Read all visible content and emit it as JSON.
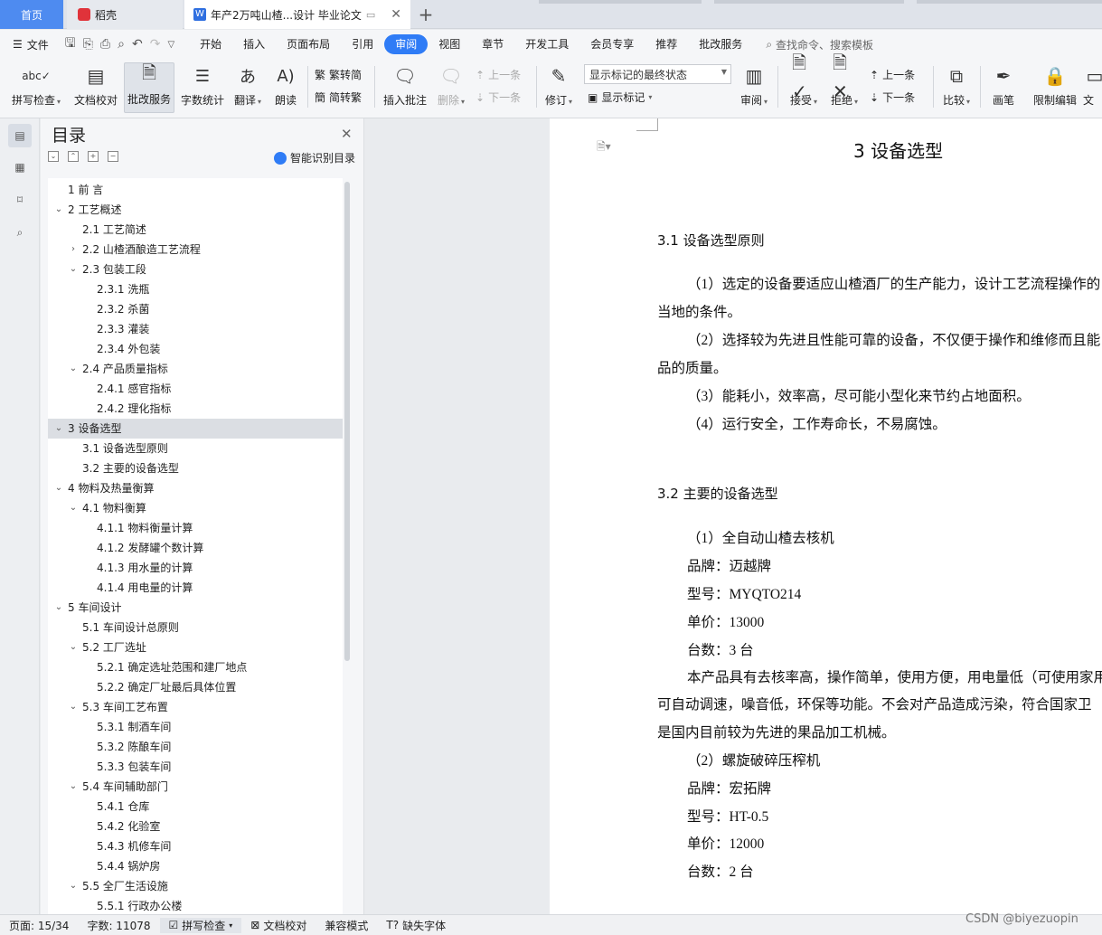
{
  "tabs": {
    "home": "首页",
    "daoke": "稻壳",
    "doc": "年产2万吨山楂...设计 毕业论文"
  },
  "menu": {
    "file": "文件",
    "items": [
      "开始",
      "插入",
      "页面布局",
      "引用",
      "审阅",
      "视图",
      "章节",
      "开发工具",
      "会员专享",
      "推荐",
      "批改服务"
    ],
    "active": "审阅",
    "search": "查找命令、搜索模板"
  },
  "ribbon": {
    "spell": "拼写检查",
    "doccheck": "文档校对",
    "correction": "批改服务",
    "wordcount": "字数统计",
    "translate": "翻译",
    "read": "朗读",
    "trad": "繁转简",
    "simp": "简转繁",
    "insert_comment": "插入批注",
    "delete": "删除",
    "prev": "上一条",
    "next": "下一条",
    "revise": "修订",
    "markup_state": "显示标记的最终状态",
    "show_markup": "显示标记",
    "review": "审阅",
    "accept": "接受",
    "reject": "拒绝",
    "prev2": "上一条",
    "next2": "下一条",
    "compare": "比较",
    "pen": "画笔",
    "restrict": "限制编辑",
    "doc_more": "文"
  },
  "toc": {
    "title": "目录",
    "smart": "智能识别目录",
    "items": [
      {
        "t": "1   前 言",
        "lvl": 0,
        "tw": ""
      },
      {
        "t": "2   工艺概述",
        "lvl": 0,
        "tw": "v"
      },
      {
        "t": "2.1  工艺简述",
        "lvl": 1,
        "tw": ""
      },
      {
        "t": "2.2  山楂酒酿造工艺流程",
        "lvl": 1,
        "tw": ">"
      },
      {
        "t": "2.3 包装工段",
        "lvl": 1,
        "tw": "v"
      },
      {
        "t": "2.3.1 洗瓶",
        "lvl": 2,
        "tw": ""
      },
      {
        "t": "2.3.2 杀菌",
        "lvl": 2,
        "tw": ""
      },
      {
        "t": "2.3.3 灌装",
        "lvl": 2,
        "tw": ""
      },
      {
        "t": "2.3.4 外包装",
        "lvl": 2,
        "tw": ""
      },
      {
        "t": "2.4 产品质量指标",
        "lvl": 1,
        "tw": "v"
      },
      {
        "t": "2.4.1 感官指标",
        "lvl": 2,
        "tw": ""
      },
      {
        "t": "2.4.2 理化指标",
        "lvl": 2,
        "tw": ""
      },
      {
        "t": "3   设备选型",
        "lvl": 0,
        "tw": "v",
        "sel": true
      },
      {
        "t": "3.1 设备选型原则",
        "lvl": 1,
        "tw": ""
      },
      {
        "t": "3.2 主要的设备选型",
        "lvl": 1,
        "tw": ""
      },
      {
        "t": "4   物料及热量衡算",
        "lvl": 0,
        "tw": "v"
      },
      {
        "t": "4.1 物料衡算",
        "lvl": 1,
        "tw": "v"
      },
      {
        "t": "4.1.1 物料衡量计算",
        "lvl": 2,
        "tw": ""
      },
      {
        "t": "4.1.2 发酵罐个数计算",
        "lvl": 2,
        "tw": ""
      },
      {
        "t": "4.1.3 用水量的计算",
        "lvl": 2,
        "tw": ""
      },
      {
        "t": "4.1.4 用电量的计算",
        "lvl": 2,
        "tw": ""
      },
      {
        "t": "5   车间设计",
        "lvl": 0,
        "tw": "v"
      },
      {
        "t": "5.1 车间设计总原则",
        "lvl": 1,
        "tw": ""
      },
      {
        "t": "5.2  工厂选址",
        "lvl": 1,
        "tw": "v"
      },
      {
        "t": "5.2.1  确定选址范围和建厂地点",
        "lvl": 2,
        "tw": ""
      },
      {
        "t": "5.2.2  确定厂址最后具体位置",
        "lvl": 2,
        "tw": ""
      },
      {
        "t": "5.3  车间工艺布置",
        "lvl": 1,
        "tw": "v"
      },
      {
        "t": "5.3.1 制酒车间",
        "lvl": 2,
        "tw": ""
      },
      {
        "t": "5.3.2 陈酿车间",
        "lvl": 2,
        "tw": ""
      },
      {
        "t": "5.3.3 包装车间",
        "lvl": 2,
        "tw": ""
      },
      {
        "t": "5.4 车间辅助部门",
        "lvl": 1,
        "tw": "v"
      },
      {
        "t": "5.4.1 仓库",
        "lvl": 2,
        "tw": ""
      },
      {
        "t": "5.4.2 化验室",
        "lvl": 2,
        "tw": ""
      },
      {
        "t": "5.4.3 机修车间",
        "lvl": 2,
        "tw": ""
      },
      {
        "t": "5.4.4 锅炉房",
        "lvl": 2,
        "tw": ""
      },
      {
        "t": "5.5 全厂生活设施",
        "lvl": 1,
        "tw": "v"
      },
      {
        "t": "5.5.1 行政办公楼",
        "lvl": 2,
        "tw": ""
      }
    ]
  },
  "document": {
    "heading": "3   设备选型",
    "s31": "3.1 设备选型原则",
    "p1a": "（1）选定的设备要适应山楂酒厂的生产能力，设计工艺流程操作的",
    "p1b": "当地的条件。",
    "p2a": "（2）选择较为先进且性能可靠的设备，不仅便于操作和维修而且能",
    "p2b": "品的质量。",
    "p3": "（3）能耗小，效率高，尽可能小型化来节约占地面积。",
    "p4": "（4）运行安全，工作寿命长，不易腐蚀。",
    "s32": "3.2 主要的设备选型",
    "e1": "（1）全自动山楂去核机",
    "e1brand": "品牌：迈越牌",
    "e1model": "型号：MYQTO214",
    "e1price": "单价：13000",
    "e1count": "台数：3 台",
    "desc1": "本产品具有去核率高，操作简单，使用方便，用电量低（可使用家用",
    "desc2": "可自动调速，噪音低，环保等功能。不会对产品造成污染，符合国家卫",
    "desc3": "是国内目前较为先进的果品加工机械。",
    "e2": "（2）螺旋破碎压榨机",
    "e2brand": "品牌：宏拓牌",
    "e2model": "型号：HT-0.5",
    "e2price": "单价：12000",
    "e2count": "台数：2 台"
  },
  "status": {
    "page": "页面: 15/34",
    "words": "字数: 11078",
    "spell": "拼写检查",
    "doccheck": "文档校对",
    "compat": "兼容模式",
    "missing_font": "缺失字体"
  },
  "watermark": "CSDN @biyezuopin"
}
